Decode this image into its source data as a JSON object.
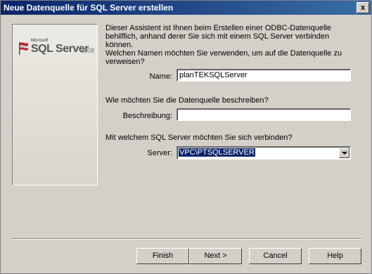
{
  "window": {
    "title": "Neue Datenquelle für SQL Server erstellen",
    "close_label": "x"
  },
  "logo": {
    "vendor": "Microsoft",
    "product": "SQL Server",
    "version": "2008"
  },
  "intro_line1": "Dieser Assistent ist Ihnen beim Erstellen einer ODBC-Datenquelle",
  "intro_line2": "behilflich, anhand derer Sie sich mit einem SQL Server verbinden können.",
  "name_question_line1": "Welchen Namen möchten Sie verwenden, um auf die Datenquelle zu",
  "name_question_line2": "verweisen?",
  "name": {
    "label": "Name:",
    "value": "planTEKSQLServer"
  },
  "description_question": "Wie möchten Sie die Datenquelle beschreiben?",
  "description": {
    "label": "Beschreibung:",
    "value": ""
  },
  "server_question": "Mit welchem SQL Server möchten Sie sich verbinden?",
  "server": {
    "label": "Server:",
    "selected": "VPC\\PTSQLSERVER"
  },
  "buttons": {
    "finish": "Finish",
    "next": "Next >",
    "cancel": "Cancel",
    "help": "Help"
  }
}
